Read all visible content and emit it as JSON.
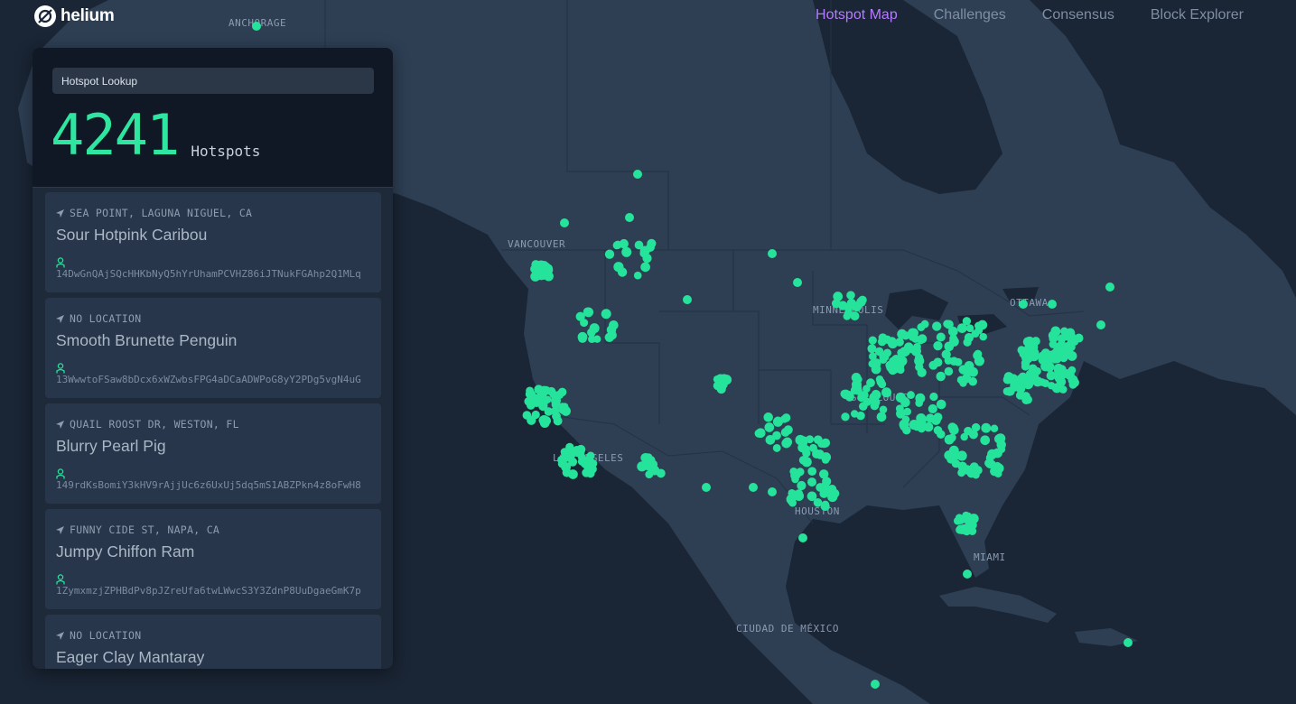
{
  "brand": {
    "name": "helium"
  },
  "nav": [
    {
      "label": "Hotspot Map",
      "active": true
    },
    {
      "label": "Challenges",
      "active": false
    },
    {
      "label": "Consensus",
      "active": false
    },
    {
      "label": "Block Explorer",
      "active": false
    }
  ],
  "sidebar": {
    "search": {
      "placeholder": "Hotspot Lookup",
      "value": ""
    },
    "hotspot_count": "4241",
    "hotspot_count_label": "Hotspots",
    "hotspots": [
      {
        "location": "SEA POINT, LAGUNA NIGUEL, CA",
        "name": "Sour Hotpink Caribou",
        "address": "14DwGnQAjSQcHHKbNyQ5hYrUhamPCVHZ86iJTNukFGAhp2Q1MLq"
      },
      {
        "location": "NO LOCATION",
        "name": "Smooth Brunette Penguin",
        "address": "13WwwtoFSaw8bDcx6xWZwbsFPG4aDCaADWPoG8yY2PDg5vgN4uG"
      },
      {
        "location": "QUAIL ROOST DR, WESTON, FL",
        "name": "Blurry Pearl Pig",
        "address": "149rdKsBomiY3kHV9rAjjUc6z6UxUj5dq5mS1ABZPkn4z8oFwH8"
      },
      {
        "location": "FUNNY CIDE ST, NAPA, CA",
        "name": "Jumpy Chiffon Ram",
        "address": "1ZymxmzjZPHBdPv8pJZreUfa6twLWwcS3Y3ZdnP8UuDgaeGmK7p"
      },
      {
        "location": "NO LOCATION",
        "name": "Eager Clay Mantaray",
        "address": ""
      }
    ]
  },
  "map": {
    "labels": [
      "ANCHORAGE",
      "VANCOUVER",
      "MINNEAPOLIS",
      "OTTAWA",
      "ST. LOUIS",
      "LOS ANGELES",
      "HOUSTON",
      "MIAMI",
      "CIUDAD DE MÉXICO"
    ],
    "colors": {
      "water": "#1a2535",
      "land": "#2e3f54",
      "border": "#233244",
      "hotspot": "#25e39b",
      "nav_active": "#b57bff"
    }
  }
}
